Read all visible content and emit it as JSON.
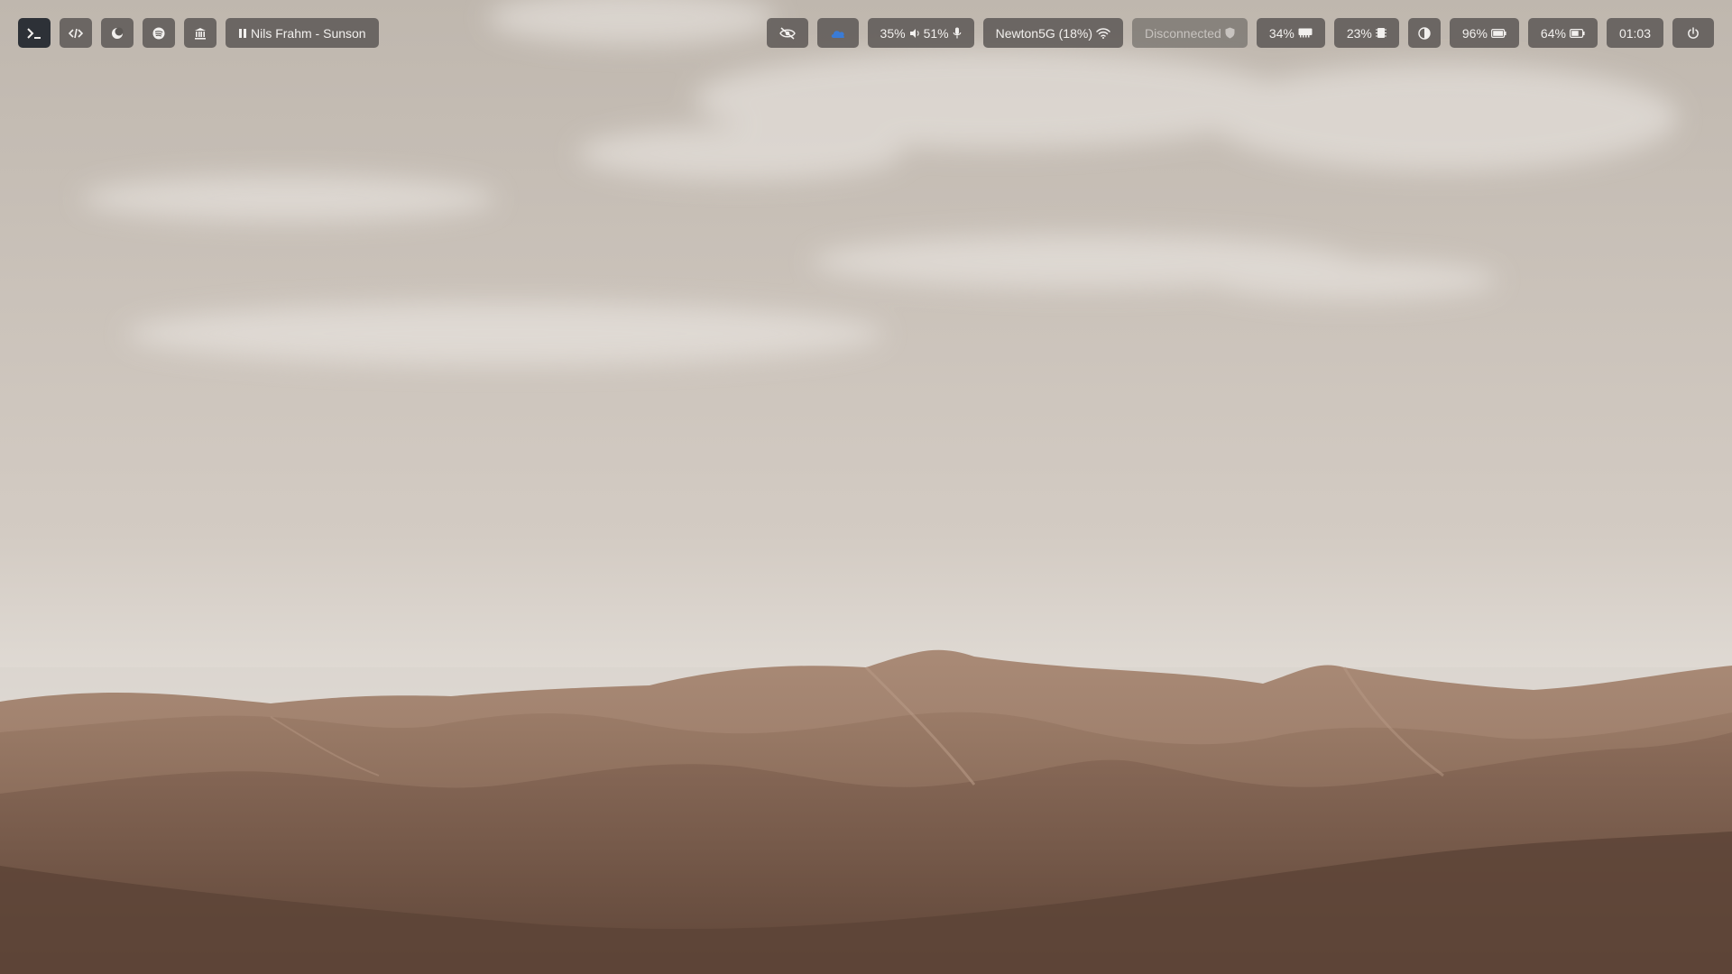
{
  "wallpaper": {
    "colors": {
      "sky_top": "#bfb7ae",
      "sky_mid": "#d3cbc3",
      "horizon": "#e2ddd7",
      "dune_light": "#a98a76",
      "dune_mid": "#8a6b59",
      "dune_shadow": "#5d4437",
      "cloud": "#efebe7"
    }
  },
  "theme": {
    "pill_bg": "#5d5956",
    "pill_active_bg": "#2d3137",
    "text": "#f2f0ee",
    "muted_text": "#c7c3bf",
    "weather_accent": "#3a7bd5"
  },
  "bar_left": {
    "workspaces": [
      {
        "icon": "terminal-icon",
        "active": true
      },
      {
        "icon": "code-icon",
        "active": false
      },
      {
        "icon": "moon-icon",
        "active": false
      },
      {
        "icon": "spotify-icon",
        "active": false
      },
      {
        "icon": "bank-icon",
        "active": false
      }
    ],
    "media": {
      "icon": "pause-icon",
      "label": "Nils Frahm - Sunson"
    }
  },
  "bar_right": {
    "privacy": {
      "icon": "eye-off-icon"
    },
    "weather": {
      "icon": "cloud-icon"
    },
    "audio": {
      "volume": "35%",
      "volume_icon": "speaker-icon",
      "mic": "51%",
      "mic_icon": "microphone-icon"
    },
    "network": {
      "label": "Newton5G (18%)",
      "icon": "wifi-icon"
    },
    "vpn": {
      "label": "Disconnected",
      "icon": "shield-icon"
    },
    "memory": {
      "label": "34%",
      "icon": "memory-icon"
    },
    "cpu": {
      "label": "23%",
      "icon": "cpu-icon"
    },
    "theme_toggle": {
      "icon": "contrast-icon"
    },
    "keyboard_battery": {
      "label": "96%",
      "icon": "battery-icon"
    },
    "battery": {
      "label": "64%",
      "icon": "battery-icon"
    },
    "clock": {
      "label": "01:03"
    },
    "power": {
      "icon": "power-icon"
    }
  }
}
